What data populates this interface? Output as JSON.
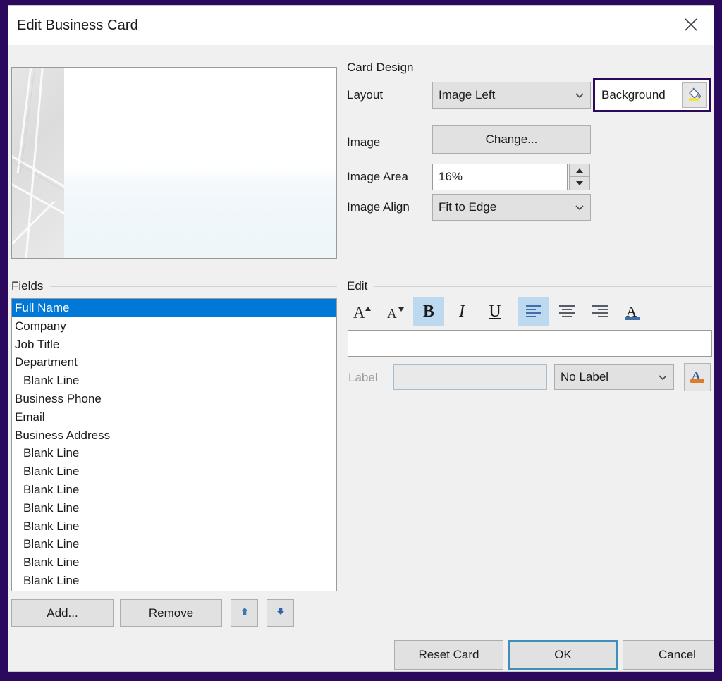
{
  "window": {
    "title": "Edit Business Card",
    "close_icon": "close-icon",
    "border_color": "#2b0a5e",
    "body_bg": "#f0f0f0"
  },
  "card_preview": {
    "name": "business-card-preview",
    "image_area_percent": 16
  },
  "card_design": {
    "group_title": "Card Design",
    "layout": {
      "label": "Layout",
      "value": "Image Left",
      "icon": "chevron-down-icon"
    },
    "background": {
      "label": "Background",
      "swatch_icon": "paint-bucket-icon",
      "highlight_color": "#2b0a5e"
    },
    "image": {
      "label": "Image",
      "button_label": "Change..."
    },
    "image_area": {
      "label": "Image Area",
      "value": "16%",
      "up_icon": "spinner-up-icon",
      "down_icon": "spinner-down-icon"
    },
    "image_align": {
      "label": "Image Align",
      "value": "Fit to Edge",
      "icon": "chevron-down-icon"
    }
  },
  "fields": {
    "group_title": "Fields",
    "selected_index": 0,
    "selection_color": "#0078d7",
    "items": [
      {
        "label": "Full Name",
        "indent": false
      },
      {
        "label": "Company",
        "indent": false
      },
      {
        "label": "Job Title",
        "indent": false
      },
      {
        "label": "Department",
        "indent": false
      },
      {
        "label": "Blank Line",
        "indent": true
      },
      {
        "label": "Business Phone",
        "indent": false
      },
      {
        "label": "Email",
        "indent": false
      },
      {
        "label": "Business Address",
        "indent": false
      },
      {
        "label": "Blank Line",
        "indent": true
      },
      {
        "label": "Blank Line",
        "indent": true
      },
      {
        "label": "Blank Line",
        "indent": true
      },
      {
        "label": "Blank Line",
        "indent": true
      },
      {
        "label": "Blank Line",
        "indent": true
      },
      {
        "label": "Blank Line",
        "indent": true
      },
      {
        "label": "Blank Line",
        "indent": true
      },
      {
        "label": "Blank Line",
        "indent": true
      }
    ],
    "buttons": {
      "add": "Add...",
      "remove": "Remove",
      "move_up_icon": "arrow-up-icon",
      "move_down_icon": "arrow-down-icon"
    }
  },
  "edit": {
    "group_title": "Edit",
    "toolbar": [
      {
        "name": "grow-font-icon",
        "glyph": "A",
        "active": false
      },
      {
        "name": "shrink-font-icon",
        "glyph": "A",
        "active": false
      },
      {
        "name": "bold-icon",
        "glyph": "B",
        "active": true
      },
      {
        "name": "italic-icon",
        "glyph": "I",
        "active": false
      },
      {
        "name": "underline-icon",
        "glyph": "U",
        "active": false
      },
      {
        "name": "align-left-icon",
        "glyph": "",
        "active": true
      },
      {
        "name": "align-center-icon",
        "glyph": "",
        "active": false
      },
      {
        "name": "align-right-icon",
        "glyph": "",
        "active": false
      },
      {
        "name": "font-color-icon",
        "glyph": "A",
        "active": false
      }
    ],
    "text_input": {
      "value": "",
      "placeholder": ""
    },
    "label_caption": "Label",
    "label_input": {
      "value": "",
      "placeholder": ""
    },
    "label_select": {
      "value": "No Label",
      "icon": "chevron-down-icon"
    },
    "highlight_button_icon": "text-highlight-icon"
  },
  "dialog_buttons": {
    "reset": "Reset Card",
    "ok": "OK",
    "cancel": "Cancel",
    "focus_color": "#3f8fb8"
  }
}
